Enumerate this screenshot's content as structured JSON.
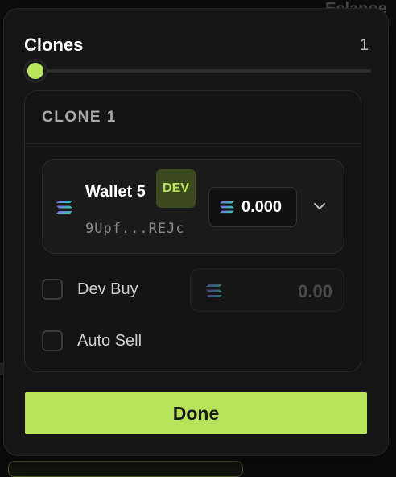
{
  "background": {
    "partial_text": "Eclanoe",
    "accent": "#b6e35a"
  },
  "clones": {
    "title": "Clones",
    "count": "1",
    "slider_value": 1
  },
  "clone_card": {
    "header": "CLONE 1",
    "wallet": {
      "name": "Wallet 5",
      "badge": "DEV",
      "address": "9Upf...REJc",
      "amount": "0.000",
      "icon": "solana-icon"
    },
    "dev_buy": {
      "label": "Dev Buy",
      "checked": false,
      "placeholder": "0.00",
      "icon": "solana-icon"
    },
    "auto_sell": {
      "label": "Auto Sell",
      "checked": false
    }
  },
  "done_label": "Done",
  "colors": {
    "accent": "#b6e35a",
    "badge_bg": "#3b4a1f",
    "panel_bg": "#151515"
  }
}
